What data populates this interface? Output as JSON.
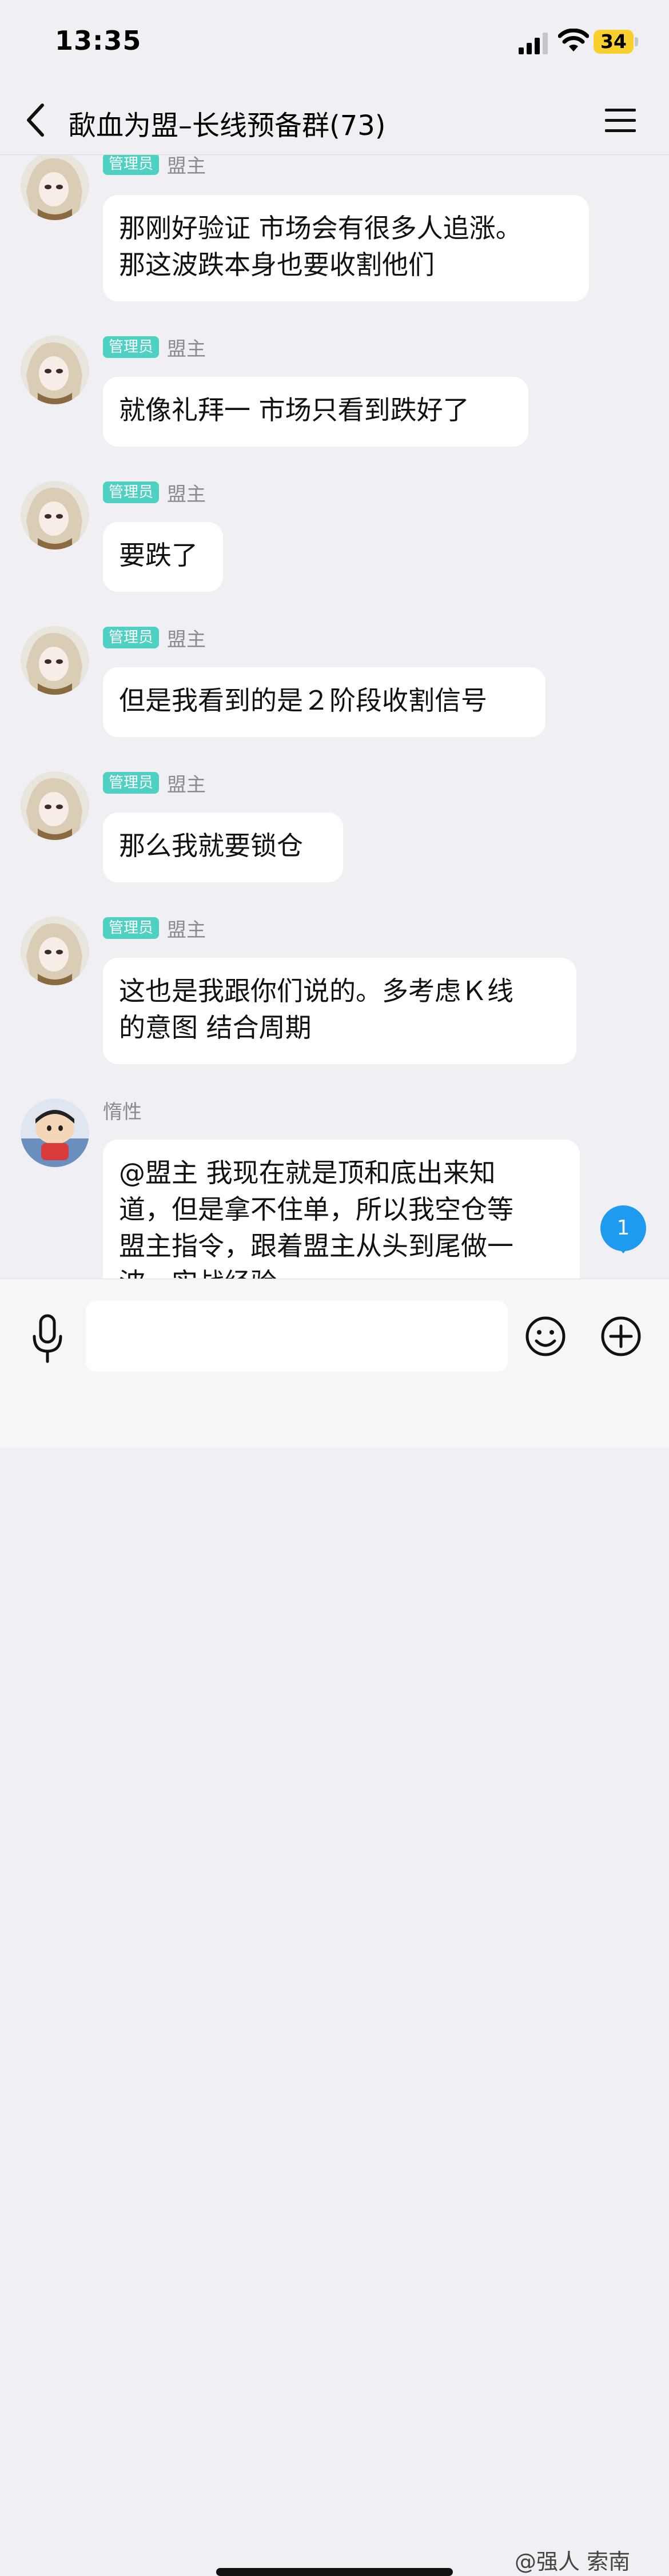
{
  "status_bar": {
    "time": "13:35",
    "battery": "34"
  },
  "header": {
    "title": "歃血为盟–长线预备群(73)"
  },
  "messages": [
    {
      "badge": "管理员",
      "sender": "盟主",
      "text": "那刚好验证 市场会有很多人追涨。\n那这波跌本身也要收割他们"
    },
    {
      "badge": "管理员",
      "sender": "盟主",
      "text": "就像礼拜一 市场只看到跌好了"
    },
    {
      "badge": "管理员",
      "sender": "盟主",
      "text": "要跌了"
    },
    {
      "badge": "管理员",
      "sender": "盟主",
      "text": "但是我看到的是２阶段收割信号"
    },
    {
      "badge": "管理员",
      "sender": "盟主",
      "text": "那么我就要锁仓"
    },
    {
      "badge": "管理员",
      "sender": "盟主",
      "text": "这也是我跟你们说的。多考虑Ｋ线\n的意图 结合周期"
    },
    {
      "badge": "",
      "sender": "惰性",
      "text": "@盟主 我现在就是顶和底出来知\n道，但是拿不住单，所以我空仓等\n盟主指令，跟着盟主从头到尾做一\n波，实战经验"
    }
  ],
  "unread_count": "1",
  "input": {
    "value": "",
    "placeholder": ""
  },
  "watermark": "@强人 索南",
  "colors": {
    "badge": "#4ed0c3",
    "unread": "#1e9bf0",
    "battery": "#f8cf2c"
  }
}
